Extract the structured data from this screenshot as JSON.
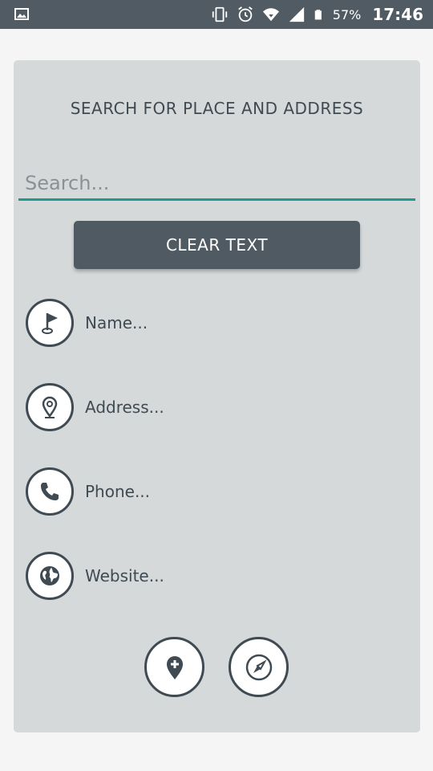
{
  "status_bar": {
    "battery_percent": "57%",
    "time": "17:46",
    "icons": [
      "image-icon",
      "vibrate-icon",
      "alarm-icon",
      "wifi-icon",
      "signal-icon",
      "battery-icon"
    ]
  },
  "card": {
    "title": "SEARCH FOR PLACE AND ADDRESS",
    "search": {
      "placeholder": "Search...",
      "value": ""
    },
    "clear_button_label": "CLEAR TEXT",
    "fields": [
      {
        "icon": "flag-icon",
        "label": "Name..."
      },
      {
        "icon": "location-pin-icon",
        "label": "Address..."
      },
      {
        "icon": "phone-icon",
        "label": "Phone..."
      },
      {
        "icon": "globe-icon",
        "label": "Website..."
      }
    ],
    "actions": [
      {
        "icon": "add-location-icon"
      },
      {
        "icon": "compass-icon"
      }
    ]
  },
  "colors": {
    "status_bar": "#515b63",
    "card_bg": "#d6d9da",
    "text_dark": "#3f4a52",
    "accent_teal": "#1f9a93",
    "button_bg": "#4f5a62"
  }
}
